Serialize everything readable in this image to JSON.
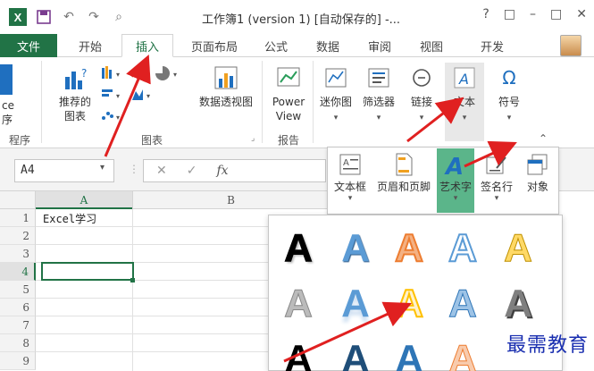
{
  "titlebar": {
    "title": "工作簿1 (version 1) [自动保存的] -...",
    "help": "?",
    "minimize": "–",
    "restore": "□",
    "close": "✕"
  },
  "tabs": {
    "file": "文件",
    "start": "开始",
    "insert": "插入",
    "page_layout": "页面布局",
    "formulas": "公式",
    "data": "数据",
    "review": "审阅",
    "view": "视图",
    "dev": "开发"
  },
  "ribbon": {
    "table_group": {
      "button_partial": "ce",
      "button_partial2": "序",
      "label": "程序"
    },
    "recommended_charts": "推荐的\n图表",
    "charts_label": "图表",
    "pivot_chart": "数据透视图",
    "power_view": "Power\nView",
    "report_label": "报告",
    "sparkline": "迷你图",
    "filter": "筛选器",
    "link": "链接",
    "text": "文本",
    "symbol": "符号"
  },
  "formula_bar": {
    "name_box": "A4",
    "cancel": "✕",
    "enter": "✓",
    "fx": "fx"
  },
  "sheet": {
    "columns": [
      "A",
      "B"
    ],
    "rows": [
      "1",
      "2",
      "3",
      "4",
      "5",
      "6",
      "7",
      "8",
      "9"
    ],
    "a1": "Excel学习"
  },
  "text_dropdown": {
    "textbox": "文本框",
    "header_footer": "页眉和页脚",
    "wordart": "艺术字",
    "signature_line": "签名行",
    "object": "对象"
  },
  "wordart_glyph": "A",
  "watermark": "最需教育",
  "colors": {
    "excel_green": "#217346",
    "arrow_red": "#e02020",
    "wordart_selected_bg": "#5bb58a"
  }
}
